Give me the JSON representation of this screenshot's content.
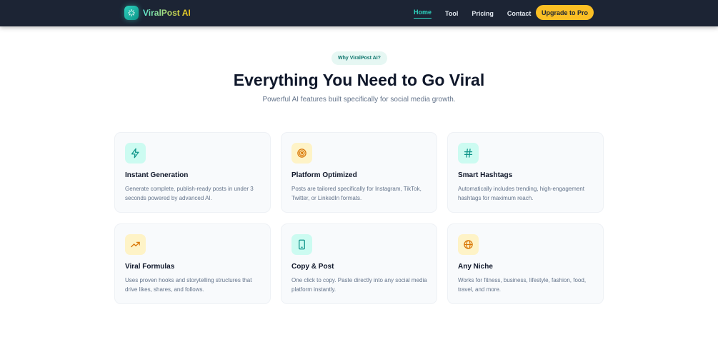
{
  "brand": {
    "name": "ViralPost AI",
    "logo_icon": "sparkles-icon",
    "accent": "#2dd4bf",
    "cta_color": "#fbbf24"
  },
  "nav": {
    "links": [
      {
        "label": "Home",
        "active": true
      },
      {
        "label": "Tool"
      },
      {
        "label": "Pricing"
      },
      {
        "label": "Contact"
      }
    ],
    "cta_label": "Upgrade to Pro"
  },
  "hero": {
    "eyebrow": "Why ViralPost AI?",
    "title": "Everything You Need to Go Viral",
    "subtitle": "Powerful AI features built specifically for social media growth."
  },
  "features": [
    {
      "icon": "lightning-bolt-icon",
      "title": "Instant Generation",
      "description": "Generate complete, publish-ready posts in under 3 seconds powered by advanced AI."
    },
    {
      "icon": "target-icon",
      "title": "Platform Optimized",
      "description": "Posts are tailored specifically for Instagram, TikTok, Twitter, or LinkedIn formats."
    },
    {
      "icon": "hashtag-icon",
      "title": "Smart Hashtags",
      "description": "Automatically includes trending, high-engagement hashtags for maximum reach."
    },
    {
      "icon": "trending-up-icon",
      "title": "Viral Formulas",
      "description": "Uses proven hooks and storytelling structures that drive likes, shares, and follows."
    },
    {
      "icon": "smartphone-icon",
      "title": "Copy & Post",
      "description": "One click to copy. Paste directly into any social media platform instantly."
    },
    {
      "icon": "globe-icon",
      "title": "Any Niche",
      "description": "Works for fitness, business, lifestyle, fashion, food, travel, and more."
    }
  ]
}
